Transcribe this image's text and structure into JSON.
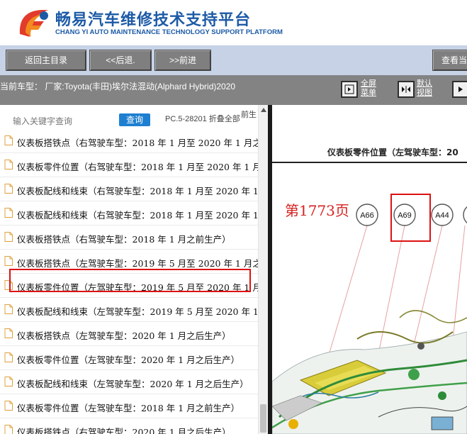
{
  "header": {
    "title_cn": "畅易汽车维修技术支持平台",
    "title_en": "CHANG YI AUTO MAINTENANCE TECHNOLOGY SUPPORT PLATFORM"
  },
  "nav": {
    "back_main": "返回主目录",
    "prev": "<<后退.",
    "next": ">>前进",
    "view": "查看当"
  },
  "info": {
    "current_model": "当前车型：  厂家:Toyota(丰田)埃尔法混动(Alphard Hybrid)2020",
    "fullscreen": [
      "全屏",
      "菜单"
    ],
    "default_view": [
      "默认",
      "视图"
    ]
  },
  "search": {
    "placeholder": "输入关键字查询",
    "button": "查询",
    "pc_text": "PC.5-28201 折叠全部",
    "pc_cut": "前生"
  },
  "list": [
    "仪表板搭铁点（右驾驶车型：2018 年 1 月至 2020 年 1 月之",
    "仪表板零件位置（右驾驶车型：2018 年 1 月至 2020 年 1 月",
    "仪表板配线和线束（右驾驶车型：2018 年 1 月至 2020 年 1",
    "仪表板配线和线束（右驾驶车型：2018 年 1 月至 2020 年 1",
    "仪表板搭铁点（右驾驶车型：2018 年 1 月之前生产）",
    "仪表板搭铁点（左驾驶车型：2019 年 5 月至 2020 年 1 月之",
    "仪表板零件位置（左驾驶车型：2019 年 5 月至 2020 年 1 月",
    "仪表板配线和线束（左驾驶车型：2019 年 5 月至 2020 年 1",
    "仪表板搭铁点（左驾驶车型：2020 年 1 月之后生产）",
    "仪表板零件位置（左驾驶车型：2020 年 1 月之后生产）",
    "仪表板配线和线束（左驾驶车型：2020 年 1 月之后生产）",
    "仪表板零件位置（左驾驶车型：2018 年 1 月之前生产）",
    "仪表板搭铁点（右驾驶车型：2020 年 1 月之后生产）"
  ],
  "diagram": {
    "title": "仪表板零件位置（左驾驶车型：20",
    "page": "第1773页",
    "connectors": [
      "A66",
      "A69",
      "A44"
    ]
  }
}
